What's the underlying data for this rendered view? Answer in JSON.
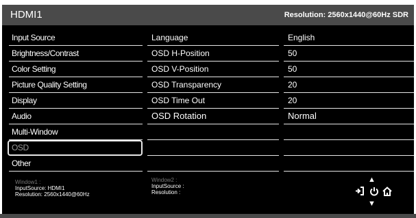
{
  "header": {
    "title": "HDMI1",
    "resolution": "Resolution: 2560x1440@60Hz SDR"
  },
  "menu": [
    "Input Source",
    "Brightness/Contrast",
    "Color Setting",
    "Picture Quality Setting",
    "Display",
    "Audio",
    "Multi-Window",
    "OSD",
    "Other"
  ],
  "settings": [
    {
      "label": "Language",
      "value": "English"
    },
    {
      "label": "OSD H-Position",
      "value": "50"
    },
    {
      "label": "OSD V-Position",
      "value": "50"
    },
    {
      "label": "OSD Transparency",
      "value": "20"
    },
    {
      "label": "OSD Time Out",
      "value": "20"
    },
    {
      "label": "OSD Rotation",
      "value": "Normal"
    }
  ],
  "window1": {
    "title": "Window1 :",
    "source": "InputSource: HDMI1",
    "resolution": "Resolution: 2560x1440@60Hz"
  },
  "window2": {
    "title": "Window2 :",
    "source": "InputSource :",
    "resolution": "Resolution :"
  },
  "colors": {
    "background": "#000000",
    "topbar": "#4a4a4a",
    "text": "#ffffff",
    "dim": "#777777"
  },
  "icons": [
    "up-arrow-icon",
    "exit-icon",
    "power-icon",
    "home-icon",
    "down-arrow-icon"
  ]
}
